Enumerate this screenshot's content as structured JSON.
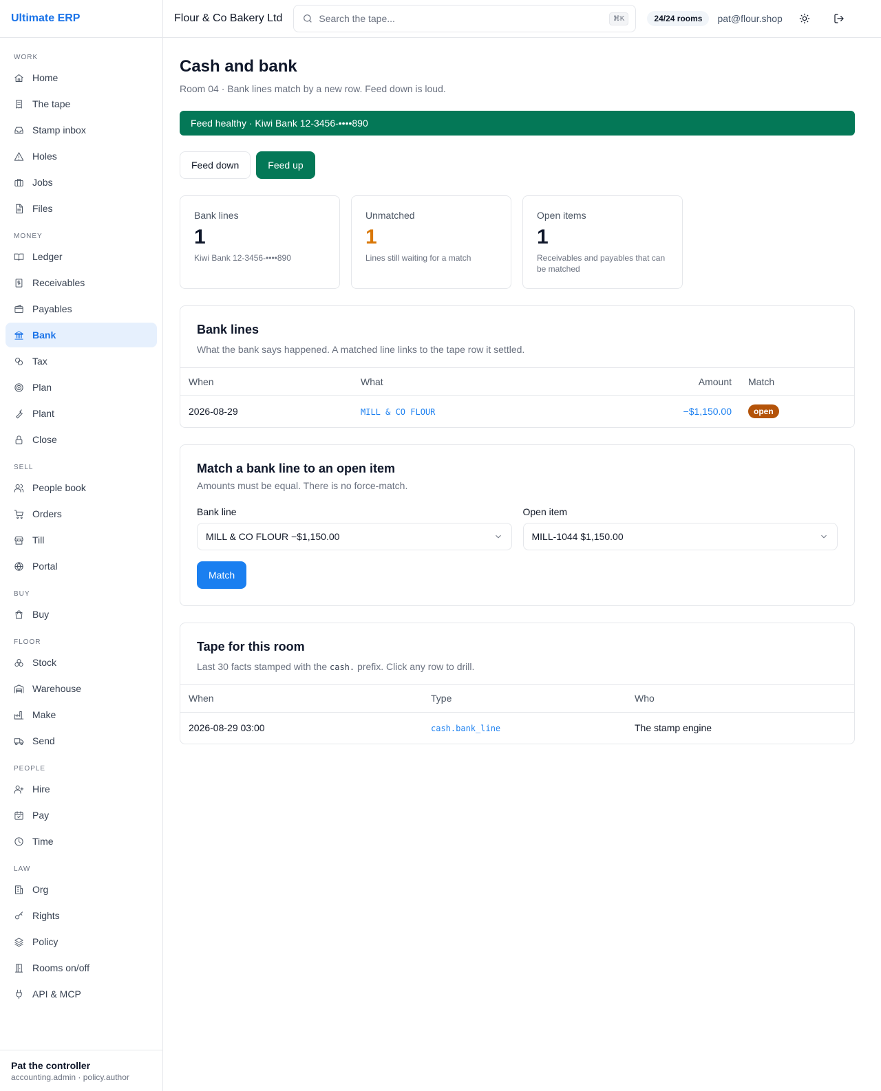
{
  "app": {
    "brand": "Ultimate ERP"
  },
  "topbar": {
    "company": "Flour & Co Bakery Ltd",
    "search_placeholder": "Search the tape...",
    "search_shortcut": "⌘K",
    "rooms": "24/24 rooms",
    "user_email": "pat@flour.shop"
  },
  "sidebar": {
    "sections": [
      {
        "label": "WORK",
        "items": [
          {
            "label": "Home",
            "icon": "home-icon"
          },
          {
            "label": "The tape",
            "icon": "receipt-icon"
          },
          {
            "label": "Stamp inbox",
            "icon": "inbox-icon"
          },
          {
            "label": "Holes",
            "icon": "warning-icon"
          },
          {
            "label": "Jobs",
            "icon": "briefcase-icon"
          },
          {
            "label": "Files",
            "icon": "file-icon"
          }
        ]
      },
      {
        "label": "MONEY",
        "items": [
          {
            "label": "Ledger",
            "icon": "book-icon"
          },
          {
            "label": "Receivables",
            "icon": "invoice-icon"
          },
          {
            "label": "Payables",
            "icon": "wallet-icon"
          },
          {
            "label": "Bank",
            "icon": "bank-icon",
            "active": true
          },
          {
            "label": "Tax",
            "icon": "percent-icon"
          },
          {
            "label": "Plan",
            "icon": "target-icon"
          },
          {
            "label": "Plant",
            "icon": "wrench-icon"
          },
          {
            "label": "Close",
            "icon": "lock-icon"
          }
        ]
      },
      {
        "label": "SELL",
        "items": [
          {
            "label": "People book",
            "icon": "users-icon"
          },
          {
            "label": "Orders",
            "icon": "cart-icon"
          },
          {
            "label": "Till",
            "icon": "store-icon"
          },
          {
            "label": "Portal",
            "icon": "globe-icon"
          }
        ]
      },
      {
        "label": "BUY",
        "items": [
          {
            "label": "Buy",
            "icon": "shopping-bag-icon"
          }
        ]
      },
      {
        "label": "FLOOR",
        "items": [
          {
            "label": "Stock",
            "icon": "boxes-icon"
          },
          {
            "label": "Warehouse",
            "icon": "warehouse-icon"
          },
          {
            "label": "Make",
            "icon": "factory-icon"
          },
          {
            "label": "Send",
            "icon": "truck-icon"
          }
        ]
      },
      {
        "label": "PEOPLE",
        "items": [
          {
            "label": "Hire",
            "icon": "user-plus-icon"
          },
          {
            "label": "Pay",
            "icon": "calendar-check-icon"
          },
          {
            "label": "Time",
            "icon": "clock-icon"
          }
        ]
      },
      {
        "label": "LAW",
        "items": [
          {
            "label": "Org",
            "icon": "building-icon"
          },
          {
            "label": "Rights",
            "icon": "key-icon"
          },
          {
            "label": "Policy",
            "icon": "layers-icon"
          },
          {
            "label": "Rooms on/off",
            "icon": "door-icon"
          },
          {
            "label": "API & MCP",
            "icon": "plug-icon"
          }
        ]
      }
    ],
    "user": {
      "name": "Pat the controller",
      "roles": "accounting.admin · policy.author"
    }
  },
  "page": {
    "title": "Cash and bank",
    "subtitle": "Room 04 · Bank lines match by a new row. Feed down is loud.",
    "banner": "Feed healthy · Kiwi Bank 12-3456-••••890",
    "banner_color": "#047857",
    "feed_down_label": "Feed down",
    "feed_up_label": "Feed up"
  },
  "stats": [
    {
      "label": "Bank lines",
      "value": "1",
      "note": "Kiwi Bank 12-3456-••••890"
    },
    {
      "label": "Unmatched",
      "value": "1",
      "note": "Lines still waiting for a match",
      "color": "#d97706"
    },
    {
      "label": "Open items",
      "value": "1",
      "note": "Receivables and payables that can be matched"
    }
  ],
  "bank_lines": {
    "title": "Bank lines",
    "subtitle": "What the bank says happened. A matched line links to the tape row it settled.",
    "columns": [
      "When",
      "What",
      "Amount",
      "Match"
    ],
    "rows": [
      {
        "when": "2026-08-29",
        "what": "MILL & CO FLOUR",
        "amount": "−$1,150.00",
        "match": "open"
      }
    ]
  },
  "match_form": {
    "title": "Match a bank line to an open item",
    "subtitle": "Amounts must be equal. There is no force-match.",
    "bank_line_label": "Bank line",
    "bank_line_value": "MILL & CO FLOUR −$1,150.00",
    "open_item_label": "Open item",
    "open_item_value": "MILL-1044 $1,150.00",
    "match_label": "Match"
  },
  "tape": {
    "title": "Tape for this room",
    "subtitle_before": "Last 30 facts stamped with the ",
    "subtitle_code": "cash.",
    "subtitle_after": " prefix. Click any row to drill.",
    "columns": [
      "When",
      "Type",
      "Who"
    ],
    "rows": [
      {
        "when": "2026-08-29 03:00",
        "type": "cash.bank_line",
        "who": "The stamp engine"
      }
    ]
  }
}
